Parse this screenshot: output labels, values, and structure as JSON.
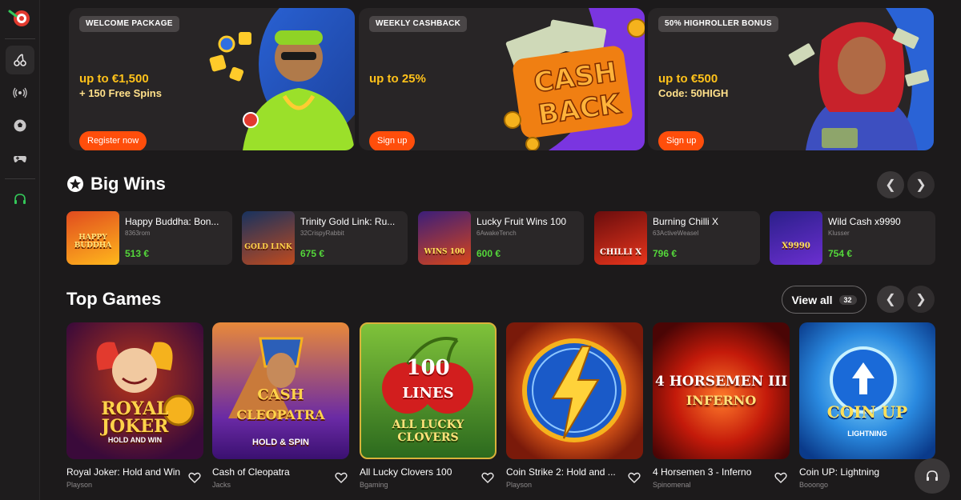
{
  "colors": {
    "accent": "#ff4e0b",
    "win": "#54d73a",
    "gold": "#ffc21a"
  },
  "sidebar": {
    "items": [
      {
        "icon": "poker-chip-icon"
      },
      {
        "icon": "cherries-icon"
      },
      {
        "icon": "live-broadcast-icon"
      },
      {
        "icon": "soccer-ball-icon"
      },
      {
        "icon": "gamepad-icon"
      },
      {
        "icon": "headset-icon"
      }
    ]
  },
  "banners": [
    {
      "tag": "WELCOME PACKAGE",
      "amount": "up to €1,500",
      "sub": "+ 150 Free Spins",
      "button": "Register now"
    },
    {
      "tag": "WEEKLY CASHBACK",
      "amount": "up to 25%",
      "sub": "",
      "button": "Sign up",
      "art_text_1": "CASH",
      "art_text_2": "BACK"
    },
    {
      "tag": "50% HIGHROLLER BONUS",
      "amount": "up to €500",
      "sub": "Code: 50HIGH",
      "button": "Sign up"
    }
  ],
  "big_wins": {
    "title": "Big Wins",
    "items": [
      {
        "name": "Happy Buddha: Bon...",
        "user": "8363rom",
        "amount": "513 €",
        "art": "HAPPY BUDDHA"
      },
      {
        "name": "Trinity Gold Link: Ru...",
        "user": "32CrispyRabbit",
        "amount": "675 €",
        "art": "GOLD LINK"
      },
      {
        "name": "Lucky Fruit Wins 100",
        "user": "6AwakeTench",
        "amount": "600 €",
        "art": "WINS 100"
      },
      {
        "name": "Burning Chilli X",
        "user": "63ActiveWeasel",
        "amount": "796 €",
        "art": "CHILLI X"
      },
      {
        "name": "Wild Cash x9990",
        "user": "Klusser",
        "amount": "754 €",
        "art": "X9990"
      }
    ]
  },
  "top_games": {
    "title": "Top Games",
    "view_all": "View all",
    "count": "32",
    "items": [
      {
        "title": "Royal Joker: Hold and Win",
        "provider": "Playson",
        "art_1": "ROYAL",
        "art_2": "JOKER",
        "art_3": "HOLD AND WIN"
      },
      {
        "title": "Cash of Cleopatra",
        "provider": "Jacks",
        "art_1": "CASH",
        "art_2": "CLEOPATRA",
        "art_3": "HOLD & SPIN"
      },
      {
        "title": "All Lucky Clovers 100",
        "provider": "Bgaming",
        "art_1": "100",
        "art_2": "LINES",
        "art_3": "ALL LUCKY CLOVERS"
      },
      {
        "title": "Coin Strike 2: Hold and ...",
        "provider": "Playson",
        "art_1": "",
        "art_2": "",
        "art_3": ""
      },
      {
        "title": "4 Horsemen 3 - Inferno",
        "provider": "Spinomenal",
        "art_1": "4 HORSEMEN III",
        "art_2": "INFERNO",
        "art_3": ""
      },
      {
        "title": "Coin UP: Lightning",
        "provider": "Booongo",
        "art_1": "COIN UP",
        "art_2": "LIGHTNING",
        "art_3": ""
      }
    ]
  }
}
